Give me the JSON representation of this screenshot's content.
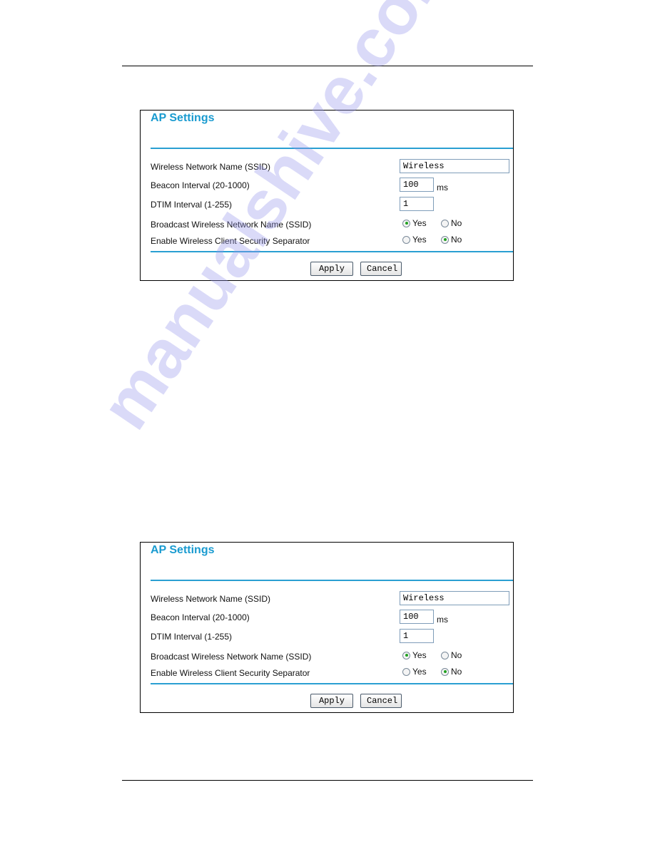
{
  "watermark": "manualshive.com",
  "panels": [
    {
      "title": "AP Settings",
      "fields": {
        "ssid_label": "Wireless Network Name (SSID)",
        "ssid_value": "Wireless",
        "beacon_label": "Beacon Interval (20-1000)",
        "beacon_value": "100",
        "beacon_unit": "ms",
        "dtim_label": "DTIM Interval (1-255)",
        "dtim_value": "1",
        "broadcast_label": "Broadcast Wireless Network Name (SSID)",
        "broadcast_selected": "Yes",
        "separator_label": "Enable Wireless Client Security Separator",
        "separator_selected": "No"
      },
      "options": {
        "yes": "Yes",
        "no": "No"
      },
      "buttons": {
        "apply": "Apply",
        "cancel": "Cancel"
      }
    },
    {
      "title": "AP Settings",
      "fields": {
        "ssid_label": "Wireless Network Name (SSID)",
        "ssid_value": "Wireless",
        "beacon_label": "Beacon Interval (20-1000)",
        "beacon_value": "100",
        "beacon_unit": "ms",
        "dtim_label": "DTIM Interval (1-255)",
        "dtim_value": "1",
        "broadcast_label": "Broadcast Wireless Network Name (SSID)",
        "broadcast_selected": "Yes",
        "separator_label": "Enable Wireless Client Security Separator",
        "separator_selected": "No"
      },
      "options": {
        "yes": "Yes",
        "no": "No"
      },
      "buttons": {
        "apply": "Apply",
        "cancel": "Cancel"
      }
    }
  ],
  "colors": {
    "accent": "#1a9bd0",
    "radio_dot": "#21a121"
  }
}
